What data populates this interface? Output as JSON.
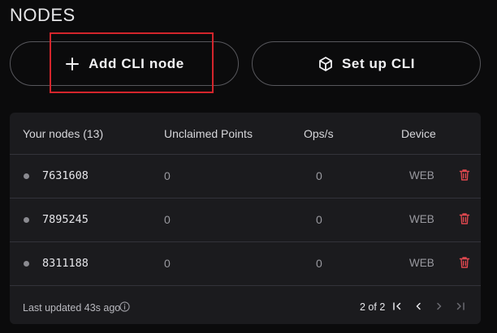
{
  "page": {
    "title": "NODES"
  },
  "actions": {
    "add_cli_node": "Add CLI node",
    "set_up_cli": "Set up CLI"
  },
  "table": {
    "headers": {
      "nodes": "Your nodes (13)",
      "points": "Unclaimed Points",
      "ops": "Ops/s",
      "device": "Device"
    },
    "rows": [
      {
        "id": "7631608",
        "points": "0",
        "ops": "0",
        "device": "WEB"
      },
      {
        "id": "7895245",
        "points": "0",
        "ops": "0",
        "device": "WEB"
      },
      {
        "id": "8311188",
        "points": "0",
        "ops": "0",
        "device": "WEB"
      }
    ],
    "footer": {
      "last_updated": "Last updated 43s ago",
      "pagination": "2 of 2"
    }
  },
  "colors": {
    "background": "#0b0b0c",
    "table_background": "#1b1b1e",
    "delete_icon": "#e0484f",
    "highlight_box": "#d4252c"
  },
  "icons": {
    "add": "plus-icon",
    "setup": "cube-icon",
    "delete": "trash-icon",
    "info": "info-icon",
    "first": "first-page-icon",
    "prev": "chevron-left-icon",
    "next": "chevron-right-icon",
    "last": "last-page-icon"
  }
}
